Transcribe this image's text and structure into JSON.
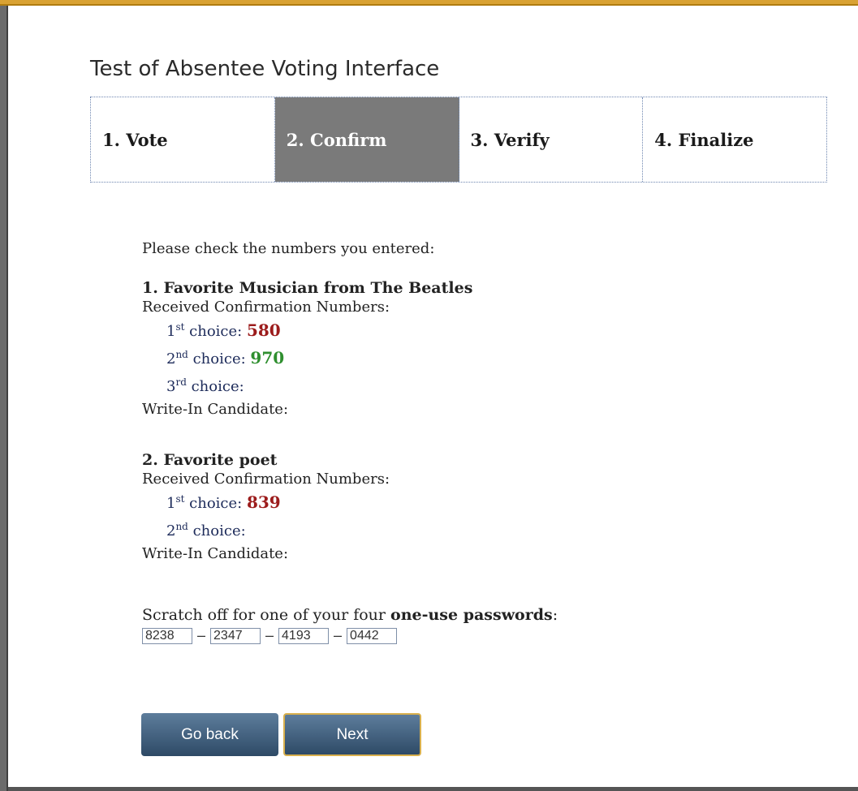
{
  "page": {
    "title": "Test of Absentee Voting Interface"
  },
  "steps": [
    {
      "label": "1. Vote",
      "active": false
    },
    {
      "label": "2. Confirm",
      "active": true
    },
    {
      "label": "3. Verify",
      "active": false
    },
    {
      "label": "4. Finalize",
      "active": false
    }
  ],
  "content": {
    "intro": "Please check the numbers you entered:",
    "questions": [
      {
        "title": "1. Favorite Musician from The Beatles",
        "received_label": "Received Confirmation Numbers:",
        "choices": [
          {
            "ordinal": "1",
            "suffix": "st",
            "label": " choice:",
            "value": "580",
            "color": "#9c1c1c"
          },
          {
            "ordinal": "2",
            "suffix": "nd",
            "label": " choice:",
            "value": "970",
            "color": "#2f8f2f"
          },
          {
            "ordinal": "3",
            "suffix": "rd",
            "label": " choice:",
            "value": ""
          }
        ],
        "writein_label": "Write-In Candidate:"
      },
      {
        "title": "2. Favorite poet",
        "received_label": "Received Confirmation Numbers:",
        "choices": [
          {
            "ordinal": "1",
            "suffix": "st",
            "label": " choice:",
            "value": "839",
            "color": "#9c1c1c"
          },
          {
            "ordinal": "2",
            "suffix": "nd",
            "label": " choice:",
            "value": ""
          }
        ],
        "writein_label": "Write-In Candidate:"
      }
    ],
    "password": {
      "label_prefix": "Scratch off for one of your four ",
      "label_bold": "one-use passwords",
      "label_suffix": ":",
      "separator": "–",
      "boxes": [
        "8238",
        "2347",
        "4193",
        "0442"
      ]
    }
  },
  "buttons": {
    "back_label": "Go back",
    "next_label": "Next"
  },
  "colors": {
    "accent_top": "#d9a233",
    "active_step_bg": "#7a7a7a",
    "button_bg": "#3f5f7f",
    "value_red": "#9c1c1c",
    "value_green": "#2f8f2f"
  }
}
